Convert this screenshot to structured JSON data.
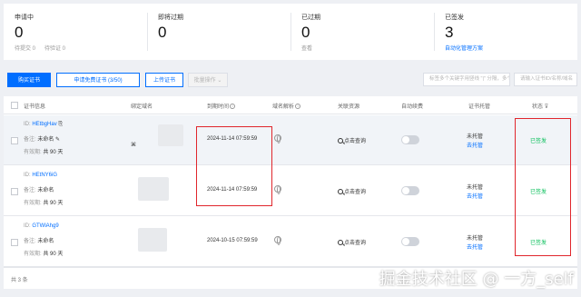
{
  "stats": [
    {
      "title": "申请中",
      "value": "0",
      "sub": [
        "待提交 0",
        "待验证 0"
      ]
    },
    {
      "title": "即将过期",
      "value": "0",
      "sub": []
    },
    {
      "title": "已过期",
      "value": "0",
      "sub": [
        "查看"
      ]
    },
    {
      "title": "已签发",
      "value": "3",
      "link": "自动化管理方案"
    }
  ],
  "toolbar": {
    "buy": "购买证书",
    "free": "申请免费证书 (3/50)",
    "upload": "上传证书",
    "batch": "批量操作",
    "search_placeholder": "标签多个关键字用竖线 \"|\" 分隔，多个过滤标签用回车键分隔",
    "search2_placeholder": "请输入证书ID/名称/域名"
  },
  "table": {
    "headers": {
      "info": "证书信息",
      "domain": "绑定域名",
      "expire": "到期时间",
      "dns": "域名解析",
      "resources": "关联资源",
      "autorenew": "自动续费",
      "hosting": "证书托管",
      "status": "状态"
    },
    "rows": [
      {
        "id": "HEtbgHav",
        "remark_label": "备注:",
        "remark": "未命名",
        "validity_label": "有效期:",
        "validity": "共 90 天",
        "expire": "2024-11-14 07:59:59",
        "resources": "点击查询",
        "hosting": "未托管",
        "hosting_link": "去托管",
        "status": "已签发"
      },
      {
        "id": "HEtNY6iG",
        "remark_label": "备注:",
        "remark": "未命名",
        "validity_label": "有效期:",
        "validity": "共 90 天",
        "expire": "2024-11-14 07:59:59",
        "resources": "点击查询",
        "hosting": "未托管",
        "hosting_link": "去托管",
        "status": "已签发"
      },
      {
        "id": "GTWlAhg9",
        "remark_label": "备注:",
        "remark": "未命名",
        "validity_label": "有效期:",
        "validity": "共 90 天",
        "expire": "2024-10-15 07:59:59",
        "resources": "点击查询",
        "hosting": "未托管",
        "hosting_link": "去托管",
        "status": "已签发"
      }
    ],
    "total": "共 3 条"
  },
  "watermark": "掘金技术社区 @ 一方_self",
  "colors": {
    "accent": "#006eff",
    "issued": "#0abf5b",
    "highlight": "#e0262c"
  }
}
